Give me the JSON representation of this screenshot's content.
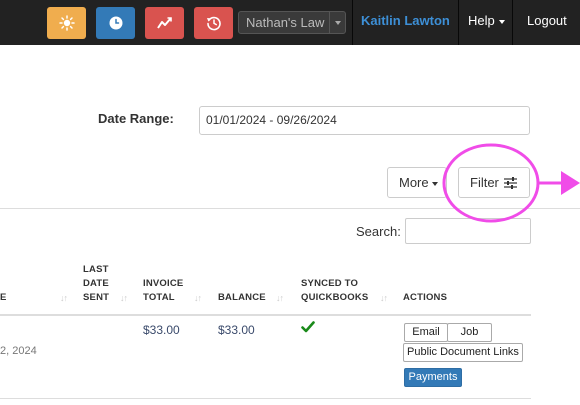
{
  "topnav": {
    "buttons": [
      {
        "icon": "sun-icon",
        "color": "#f0ad4e"
      },
      {
        "icon": "clock-icon",
        "color": "#337ab7"
      },
      {
        "icon": "trend-chart-icon",
        "color": "#d9534f"
      },
      {
        "icon": "history-icon",
        "color": "#d9534f"
      }
    ],
    "firm_select": "Nathan's Law",
    "user": "Kaitlin Lawton",
    "help": "Help",
    "logout": "Logout"
  },
  "filters": {
    "date_range_label": "Date Range:",
    "date_range_value": "01/01/2024 - 09/26/2024",
    "more_label": "More",
    "filter_label": "Filter"
  },
  "search": {
    "label": "Search:",
    "value": ""
  },
  "table": {
    "columns": [
      {
        "lines": [
          "E"
        ]
      },
      {
        "lines": [
          "LAST",
          "DATE",
          "SENT"
        ]
      },
      {
        "lines": [
          "INVOICE",
          "TOTAL"
        ]
      },
      {
        "lines": [
          "BALANCE"
        ]
      },
      {
        "lines": [
          "SYNCED TO",
          "QUICKBOOKS"
        ]
      },
      {
        "lines": [
          "ACTIONS"
        ]
      }
    ],
    "rows": [
      {
        "date_partial": "2, 2024",
        "invoice_total": "$33.00",
        "balance": "$33.00",
        "synced": true,
        "actions": [
          "Email",
          "Job",
          "Public Document Links",
          "Payments"
        ]
      }
    ]
  },
  "colors": {
    "annotation": "#f04ce8",
    "synced_check": "#1a8a1a",
    "primary": "#337ab7"
  }
}
